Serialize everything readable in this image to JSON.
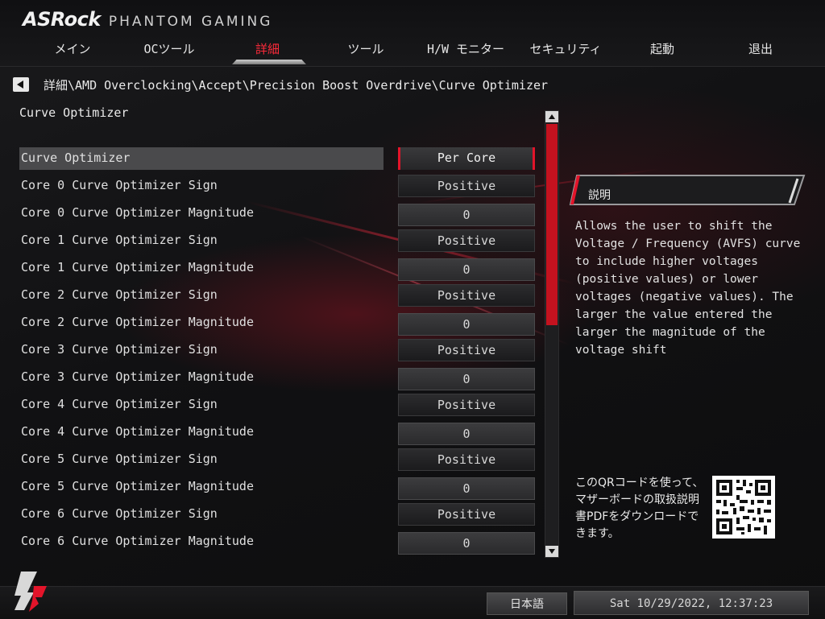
{
  "app": {
    "brand": "ASRock",
    "subtitle": "PHANTOM GAMING"
  },
  "tabs": [
    {
      "label": "メイン",
      "active": false
    },
    {
      "label": "OCツール",
      "active": false
    },
    {
      "label": "詳細",
      "active": true
    },
    {
      "label": "ツール",
      "active": false
    },
    {
      "label": "H/W モニター",
      "active": false
    },
    {
      "label": "セキュリティ",
      "active": false
    },
    {
      "label": "起動",
      "active": false
    },
    {
      "label": "退出",
      "active": false
    }
  ],
  "breadcrumb": "詳細\\AMD Overclocking\\Accept\\Precision Boost Overdrive\\Curve Optimizer",
  "section_title": "Curve Optimizer",
  "settings": [
    {
      "label": "Curve Optimizer",
      "value": "Per Core",
      "selected": true
    },
    {
      "label": "Core 0 Curve Optimizer Sign",
      "value": "Positive"
    },
    {
      "label": "Core 0 Curve Optimizer Magnitude",
      "value": "0"
    },
    {
      "label": "Core 1 Curve Optimizer Sign",
      "value": "Positive"
    },
    {
      "label": "Core 1 Curve Optimizer Magnitude",
      "value": "0"
    },
    {
      "label": "Core 2 Curve Optimizer Sign",
      "value": "Positive"
    },
    {
      "label": "Core 2 Curve Optimizer Magnitude",
      "value": "0"
    },
    {
      "label": "Core 3 Curve Optimizer Sign",
      "value": "Positive"
    },
    {
      "label": "Core 3 Curve Optimizer Magnitude",
      "value": "0"
    },
    {
      "label": "Core 4 Curve Optimizer Sign",
      "value": "Positive"
    },
    {
      "label": "Core 4 Curve Optimizer Magnitude",
      "value": "0"
    },
    {
      "label": "Core 5 Curve Optimizer Sign",
      "value": "Positive"
    },
    {
      "label": "Core 5 Curve Optimizer Magnitude",
      "value": "0"
    },
    {
      "label": "Core 6 Curve Optimizer Sign",
      "value": "Positive"
    },
    {
      "label": "Core 6 Curve Optimizer Magnitude",
      "value": "0"
    }
  ],
  "description": {
    "title": "説明",
    "text": "Allows the user to shift the Voltage / Frequency (AVFS) curve to include higher voltages (positive values) or lower voltages (negative values). The larger the value entered the larger the magnitude of the voltage shift"
  },
  "qr": {
    "text": "このQRコードを使って、マザーボードの取扱説明書PDFをダウンロードできます。"
  },
  "footer": {
    "language": "日本語",
    "datetime": "Sat 10/29/2022, 12:37:23"
  },
  "colors": {
    "accent": "#e3142a",
    "active_tab": "#ff2a3a",
    "background": "#0c0c0d"
  }
}
